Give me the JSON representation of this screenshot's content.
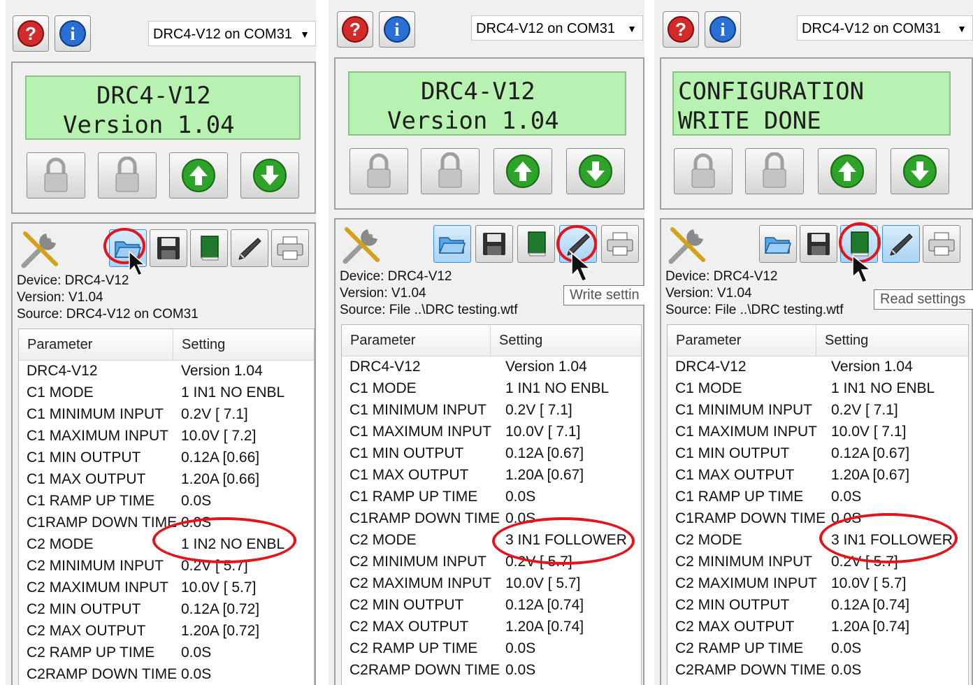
{
  "screens": [
    {
      "port": "DRC4-V12 on COM31",
      "lcd": [
        "DRC4-V12",
        "Version 1.04"
      ],
      "device": "Device: DRC4-V12",
      "version": "Version: V1.04",
      "source": "Source: DRC4-V12 on COM31",
      "tooltip": "",
      "headers": {
        "param": "Parameter",
        "setting": "Setting"
      },
      "rows": [
        {
          "p": "DRC4-V12",
          "v": "Version 1.04"
        },
        {
          "p": "C1 MODE",
          "v": "1 IN1 NO ENBL"
        },
        {
          "p": "C1 MINIMUM INPUT",
          "v": "0.2V [  7.1]"
        },
        {
          "p": "C1 MAXIMUM INPUT",
          "v": "10.0V [  7.2]"
        },
        {
          "p": "C1 MIN OUTPUT",
          "v": "0.12A [0.66]"
        },
        {
          "p": "C1 MAX OUTPUT",
          "v": "1.20A [0.66]"
        },
        {
          "p": "C1 RAMP UP TIME",
          "v": "0.0S"
        },
        {
          "p": "C1RAMP DOWN TIME",
          "v": "0.0S"
        },
        {
          "p": "C2 MODE",
          "v": "1 IN2 NO ENBL"
        },
        {
          "p": "C2 MINIMUM INPUT",
          "v": "0.2V [  5.7]"
        },
        {
          "p": "C2 MAXIMUM INPUT",
          "v": "10.0V [  5.7]"
        },
        {
          "p": "C2 MIN OUTPUT",
          "v": "0.12A [0.72]"
        },
        {
          "p": "C2 MAX OUTPUT",
          "v": "1.20A [0.72]"
        },
        {
          "p": "C2 RAMP UP TIME",
          "v": "0.0S"
        },
        {
          "p": "C2RAMP DOWN TIME",
          "v": "0.0S"
        }
      ]
    },
    {
      "port": "DRC4-V12 on COM31",
      "lcd": [
        "DRC4-V12",
        "Version 1.04"
      ],
      "device": "Device: DRC4-V12",
      "version": "Version: V1.04",
      "source": "Source: File ..\\DRC testing.wtf",
      "tooltip": "Write settin",
      "headers": {
        "param": "Parameter",
        "setting": "Setting"
      },
      "rows": [
        {
          "p": "DRC4-V12",
          "v": "Version 1.04"
        },
        {
          "p": "C1 MODE",
          "v": "1 IN1 NO ENBL"
        },
        {
          "p": "C1 MINIMUM INPUT",
          "v": "0.2V [  7.1]"
        },
        {
          "p": "C1 MAXIMUM INPUT",
          "v": "10.0V [  7.1]"
        },
        {
          "p": "C1 MIN OUTPUT",
          "v": "0.12A [0.67]"
        },
        {
          "p": "C1 MAX OUTPUT",
          "v": "1.20A [0.67]"
        },
        {
          "p": "C1 RAMP UP TIME",
          "v": "0.0S"
        },
        {
          "p": "C1RAMP DOWN TIME",
          "v": "0.0S"
        },
        {
          "p": "C2 MODE",
          "v": "3 IN1 FOLLOWER"
        },
        {
          "p": "C2 MINIMUM INPUT",
          "v": "0.2V [  5.7]"
        },
        {
          "p": "C2 MAXIMUM INPUT",
          "v": "10.0V [  5.7]"
        },
        {
          "p": "C2 MIN OUTPUT",
          "v": "0.12A [0.74]"
        },
        {
          "p": "C2 MAX OUTPUT",
          "v": "1.20A [0.74]"
        },
        {
          "p": "C2 RAMP UP TIME",
          "v": "0.0S"
        },
        {
          "p": "C2RAMP DOWN TIME",
          "v": "0.0S"
        }
      ]
    },
    {
      "port": "DRC4-V12 on COM31",
      "lcd": [
        "CONFIGURATION",
        "WRITE DONE"
      ],
      "device": "Device: DRC4-V12",
      "version": "Version: V1.04",
      "source": "Source: File ..\\DRC testing.wtf",
      "tooltip": "Read settings",
      "headers": {
        "param": "Parameter",
        "setting": "Setting"
      },
      "rows": [
        {
          "p": "DRC4-V12",
          "v": "Version 1.04"
        },
        {
          "p": "C1 MODE",
          "v": "1 IN1 NO ENBL"
        },
        {
          "p": "C1 MINIMUM INPUT",
          "v": "0.2V [  7.1]"
        },
        {
          "p": "C1 MAXIMUM INPUT",
          "v": "10.0V [  7.1]"
        },
        {
          "p": "C1 MIN OUTPUT",
          "v": "0.12A [0.67]"
        },
        {
          "p": "C1 MAX OUTPUT",
          "v": "1.20A [0.67]"
        },
        {
          "p": "C1 RAMP UP TIME",
          "v": "0.0S"
        },
        {
          "p": "C1RAMP DOWN TIME",
          "v": "0.0S"
        },
        {
          "p": "C2 MODE",
          "v": "3 IN1 FOLLOWER"
        },
        {
          "p": "C2 MINIMUM INPUT",
          "v": "0.2V [  5.7]"
        },
        {
          "p": "C2 MAXIMUM INPUT",
          "v": "10.0V [  5.7]"
        },
        {
          "p": "C2 MIN OUTPUT",
          "v": "0.12A [0.74]"
        },
        {
          "p": "C2 MAX OUTPUT",
          "v": "1.20A [0.74]"
        },
        {
          "p": "C2 RAMP UP TIME",
          "v": "0.0S"
        },
        {
          "p": "C2RAMP DOWN TIME",
          "v": "0.0S"
        }
      ]
    }
  ],
  "colors": {
    "lcd_bg": "#b8f2b0",
    "annotation_red": "#e3141b",
    "active_tool": "#a9d3f5"
  }
}
